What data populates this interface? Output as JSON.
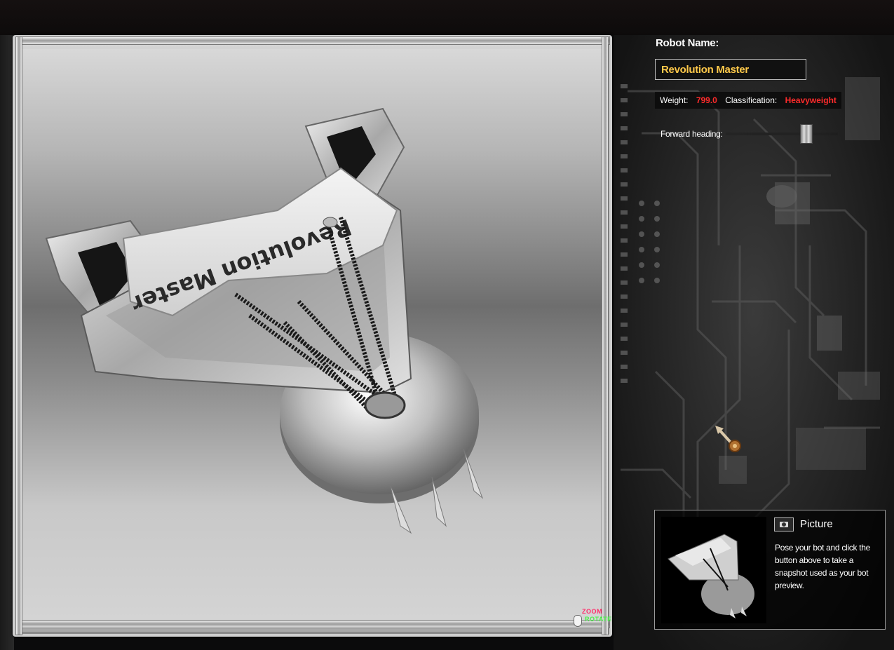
{
  "robot": {
    "name_label": "Robot Name:",
    "name_value": "Revolution Master",
    "weight_label": "Weight:",
    "weight_value": "799.0",
    "classification_label": "Classification:",
    "classification_value": "Heavyweight",
    "forward_heading_label": "Forward heading:",
    "chassis_text": "Revolution Master"
  },
  "viewport": {
    "zoom_label": "ZOOM",
    "rotate_label": "ROTATE"
  },
  "picture": {
    "title": "Picture",
    "description": "Pose your bot and click the button above to take a snapshot used as your bot preview.",
    "camera_icon": "camera-icon"
  },
  "colors": {
    "name_text": "#ffc94a",
    "stat_values": "#ff2b2b",
    "zoom": "#ff2d6a",
    "rotate": "#4bf049"
  }
}
